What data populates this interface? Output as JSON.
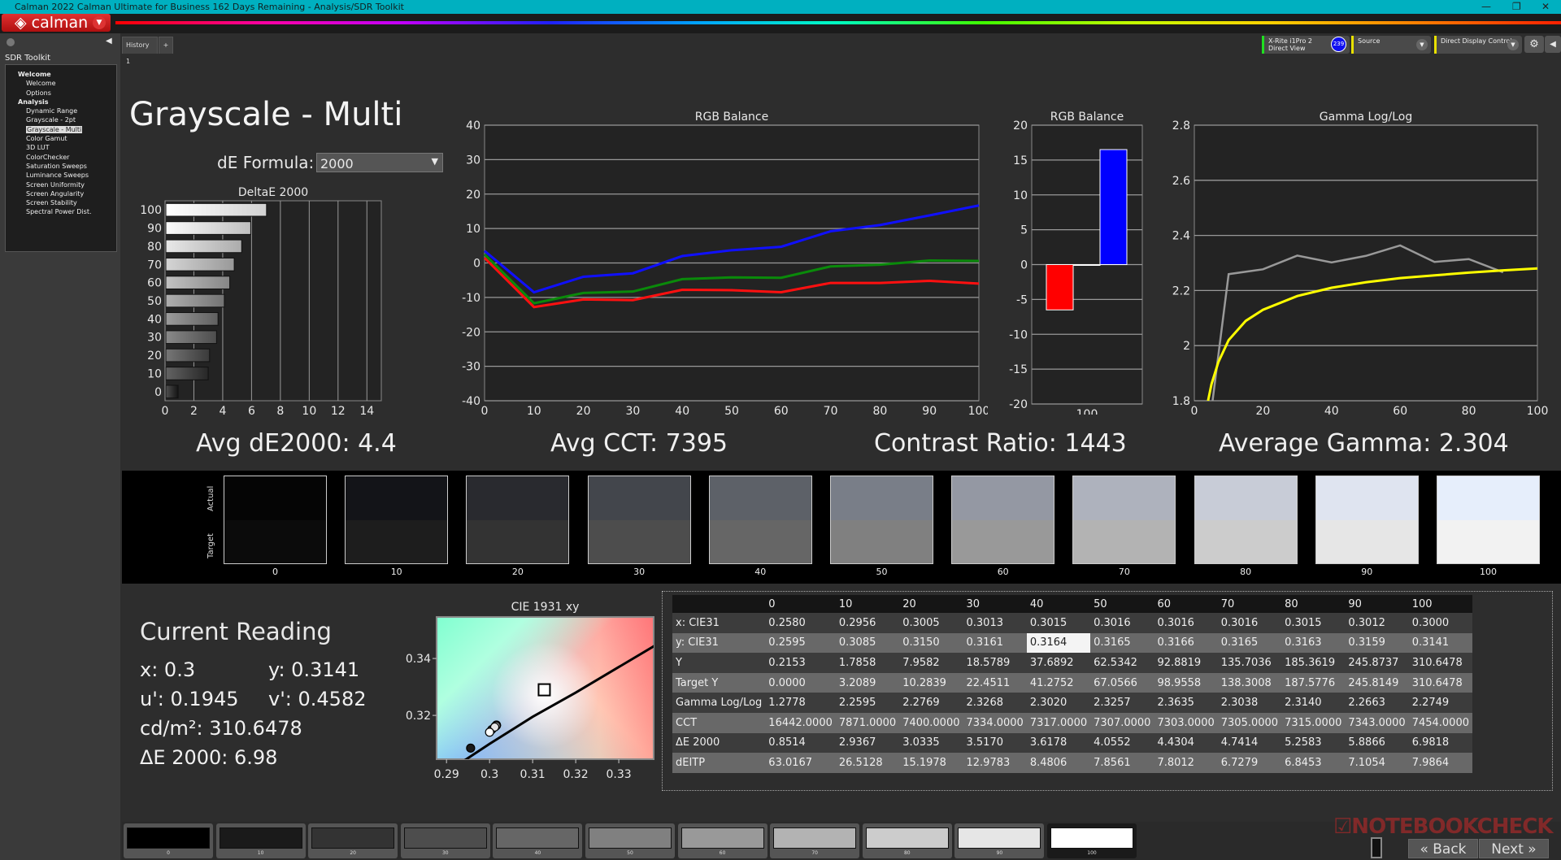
{
  "window": {
    "title": "Calman 2022 Calman Ultimate for Business 162 Days Remaining  - Analysis/SDR Toolkit",
    "min": "—",
    "max": "❐",
    "close": "✕"
  },
  "logo": "calman",
  "sidebar": {
    "title": "SDR Toolkit",
    "groups": [
      {
        "label": "Welcome",
        "items": [
          "Welcome",
          "Options"
        ]
      },
      {
        "label": "Analysis",
        "items": [
          "Dynamic Range",
          "Grayscale - 2pt",
          "Grayscale - Multi",
          "Color Gamut",
          "3D LUT",
          "ColorChecker",
          "Saturation Sweeps",
          "Luminance Sweeps",
          "Screen Uniformity",
          "Screen Angularity",
          "Screen Stability",
          "Spectral Power Dist."
        ]
      }
    ],
    "selected": "Grayscale - Multi"
  },
  "tabs": {
    "history": "History 1",
    "add": "+"
  },
  "devices": {
    "meter_line1": "X-Rite i1Pro 2",
    "meter_line2": "Direct View",
    "meter_badge": "239",
    "source": "Source",
    "display": "Direct Display Control"
  },
  "page": {
    "title": "Grayscale - Multi",
    "de_formula_label": "dE Formula:",
    "de_formula_value": "2000"
  },
  "summary": {
    "avg_de": "Avg dE2000: 4.4",
    "avg_cct": "Avg CCT: 7395",
    "contrast": "Contrast Ratio: 1443",
    "avg_gamma": "Average Gamma: 2.304"
  },
  "chart_data": [
    {
      "type": "bar",
      "orientation": "horizontal",
      "title": "DeltaE 2000",
      "categories": [
        "0",
        "10",
        "20",
        "30",
        "40",
        "50",
        "60",
        "70",
        "80",
        "90",
        "100"
      ],
      "values": [
        0.8514,
        2.9367,
        3.0335,
        3.517,
        3.6178,
        4.0552,
        4.4304,
        4.7414,
        5.2583,
        5.8866,
        6.9818
      ],
      "xlim": [
        0,
        15
      ],
      "xticks": [
        0,
        2,
        4,
        6,
        8,
        10,
        12,
        14
      ],
      "grid": true
    },
    {
      "type": "line",
      "title": "RGB Balance",
      "x": [
        0,
        10,
        20,
        30,
        40,
        50,
        60,
        70,
        80,
        90,
        100
      ],
      "xlim": [
        0,
        100
      ],
      "ylim": [
        -40,
        40
      ],
      "xticks": [
        0,
        10,
        20,
        30,
        40,
        50,
        60,
        70,
        80,
        90,
        100
      ],
      "yticks": [
        -40,
        -30,
        -20,
        -10,
        0,
        10,
        20,
        30,
        40
      ],
      "grid": true,
      "series": [
        {
          "color": "#ff1010",
          "values": [
            1.5,
            -12.8,
            -10.6,
            -10.8,
            -7.8,
            -7.9,
            -8.5,
            -5.8,
            -5.8,
            -5.2,
            -6.0
          ]
        },
        {
          "color": "#0a8a0a",
          "values": [
            2.5,
            -11.7,
            -8.7,
            -8.3,
            -4.7,
            -4.2,
            -4.3,
            -1.0,
            -0.5,
            0.7,
            0.6
          ]
        },
        {
          "color": "#1010ff",
          "values": [
            3.5,
            -8.5,
            -4.0,
            -3.0,
            2.0,
            3.7,
            4.7,
            9.2,
            11.0,
            13.8,
            16.7
          ]
        }
      ]
    },
    {
      "type": "bar",
      "title": "RGB Balance",
      "categories": [
        "100"
      ],
      "ylim": [
        -20,
        20
      ],
      "yticks": [
        -20,
        -15,
        -10,
        -5,
        0,
        5,
        10,
        15,
        20
      ],
      "grid": true,
      "series": [
        {
          "color": "#ff0000",
          "values": [
            -6.5
          ]
        },
        {
          "color": "#00c000",
          "values": [
            0
          ]
        },
        {
          "color": "#0000ff",
          "values": [
            16.5
          ]
        }
      ]
    },
    {
      "type": "line",
      "title": "Gamma Log/Log",
      "xlim": [
        0,
        100
      ],
      "ylim": [
        1.8,
        2.8
      ],
      "xticks": [
        0,
        20,
        40,
        60,
        80,
        100
      ],
      "yticks": [
        1.8,
        2,
        2.2,
        2.4,
        2.6,
        2.8
      ],
      "grid": true,
      "series": [
        {
          "color": "#999999",
          "x": [
            0,
            10,
            20,
            30,
            40,
            50,
            60,
            70,
            80,
            90
          ],
          "values": [
            1.2778,
            2.2595,
            2.2769,
            2.3268,
            2.302,
            2.3257,
            2.3635,
            2.3038,
            2.314,
            2.2663
          ]
        },
        {
          "color": "#ffff00",
          "x": [
            4,
            5,
            7,
            10,
            15,
            20,
            30,
            40,
            50,
            60,
            70,
            80,
            90,
            100
          ],
          "values": [
            1.8,
            1.86,
            1.94,
            2.02,
            2.09,
            2.13,
            2.18,
            2.21,
            2.23,
            2.245,
            2.255,
            2.265,
            2.273,
            2.28
          ]
        }
      ]
    },
    {
      "type": "scatter",
      "title": "CIE 1931 xy",
      "xlim": [
        0.2877,
        0.3381
      ],
      "ylim": [
        0.3046,
        0.3546
      ],
      "xticks": [
        0.29,
        0.3,
        0.31,
        0.32,
        0.33
      ],
      "yticks": [
        0.32,
        0.34
      ],
      "target": {
        "x": 0.3127,
        "y": 0.329
      },
      "points": {
        "x": [
          0.258,
          0.2956,
          0.3005,
          0.3013,
          0.3015,
          0.3016,
          0.3016,
          0.3016,
          0.3015,
          0.3012,
          0.3
        ],
        "y": [
          0.2595,
          0.3085,
          0.315,
          0.3161,
          0.3164,
          0.3165,
          0.3166,
          0.3165,
          0.3163,
          0.3159,
          0.3141
        ]
      }
    }
  ],
  "swatches": {
    "actual_label": "Actual",
    "target_label": "Target",
    "items": [
      {
        "label": "0",
        "actual": "#050505",
        "target": "#0b0b0b"
      },
      {
        "label": "10",
        "actual": "#131418",
        "target": "#1d1d1d"
      },
      {
        "label": "20",
        "actual": "#292a2f",
        "target": "#333333"
      },
      {
        "label": "30",
        "actual": "#43464c",
        "target": "#4d4d4d"
      },
      {
        "label": "40",
        "actual": "#5d6168",
        "target": "#666666"
      },
      {
        "label": "50",
        "actual": "#797e88",
        "target": "#808080"
      },
      {
        "label": "60",
        "actual": "#9498a3",
        "target": "#999999"
      },
      {
        "label": "70",
        "actual": "#aeb2bd",
        "target": "#b3b3b3"
      },
      {
        "label": "80",
        "actual": "#c8ccd7",
        "target": "#cccccc"
      },
      {
        "label": "90",
        "actual": "#dfe4f0",
        "target": "#e6e6e6"
      },
      {
        "label": "100",
        "actual": "#e6eefb",
        "target": "#f2f2f2"
      }
    ]
  },
  "current": {
    "title": "Current Reading",
    "x": "x: 0.3",
    "y": "y: 0.3141",
    "u": "u': 0.1945",
    "v": "v': 0.4582",
    "lum": "cd/m²: 310.6478",
    "de": "ΔE 2000: 6.98"
  },
  "table": {
    "columns": [
      "",
      "0",
      "10",
      "20",
      "30",
      "40",
      "50",
      "60",
      "70",
      "80",
      "90",
      "100"
    ],
    "rows": [
      [
        "x: CIE31",
        "0.2580",
        "0.2956",
        "0.3005",
        "0.3013",
        "0.3015",
        "0.3016",
        "0.3016",
        "0.3016",
        "0.3015",
        "0.3012",
        "0.3000"
      ],
      [
        "y: CIE31",
        "0.2595",
        "0.3085",
        "0.3150",
        "0.3161",
        "0.3164",
        "0.3165",
        "0.3166",
        "0.3165",
        "0.3163",
        "0.3159",
        "0.3141"
      ],
      [
        "Y",
        "0.2153",
        "1.7858",
        "7.9582",
        "18.5789",
        "37.6892",
        "62.5342",
        "92.8819",
        "135.7036",
        "185.3619",
        "245.8737",
        "310.6478"
      ],
      [
        "Target Y",
        "0.0000",
        "3.2089",
        "10.2839",
        "22.4511",
        "41.2752",
        "67.0566",
        "98.9558",
        "138.3008",
        "187.5776",
        "245.8149",
        "310.6478"
      ],
      [
        "Gamma Log/Log",
        "1.2778",
        "2.2595",
        "2.2769",
        "2.3268",
        "2.3020",
        "2.3257",
        "2.3635",
        "2.3038",
        "2.3140",
        "2.2663",
        "2.2749"
      ],
      [
        "CCT",
        "16442.0000",
        "7871.0000",
        "7400.0000",
        "7334.0000",
        "7317.0000",
        "7307.0000",
        "7303.0000",
        "7305.0000",
        "7315.0000",
        "7343.0000",
        "7454.0000"
      ],
      [
        "ΔE 2000",
        "0.8514",
        "2.9367",
        "3.0335",
        "3.5170",
        "3.6178",
        "4.0552",
        "4.4304",
        "4.7414",
        "5.2583",
        "5.8866",
        "6.9818"
      ],
      [
        "dEITP",
        "63.0167",
        "26.5128",
        "15.1978",
        "12.9783",
        "8.4806",
        "7.8561",
        "7.8012",
        "6.7279",
        "6.8453",
        "7.1054",
        "7.9864"
      ]
    ],
    "selected_cell": "0.3164"
  },
  "bottom": {
    "patches": [
      {
        "label": "0",
        "color": "#000000"
      },
      {
        "label": "10",
        "color": "#1a1a1a"
      },
      {
        "label": "20",
        "color": "#333333"
      },
      {
        "label": "30",
        "color": "#4d4d4d"
      },
      {
        "label": "40",
        "color": "#666666"
      },
      {
        "label": "50",
        "color": "#808080"
      },
      {
        "label": "60",
        "color": "#999999"
      },
      {
        "label": "70",
        "color": "#b3b3b3"
      },
      {
        "label": "80",
        "color": "#cccccc"
      },
      {
        "label": "90",
        "color": "#e6e6e6"
      },
      {
        "label": "100",
        "color": "#ffffff"
      }
    ],
    "back": "« Back",
    "next": "Next »"
  },
  "watermark": "NOTEBOOKCHECK"
}
